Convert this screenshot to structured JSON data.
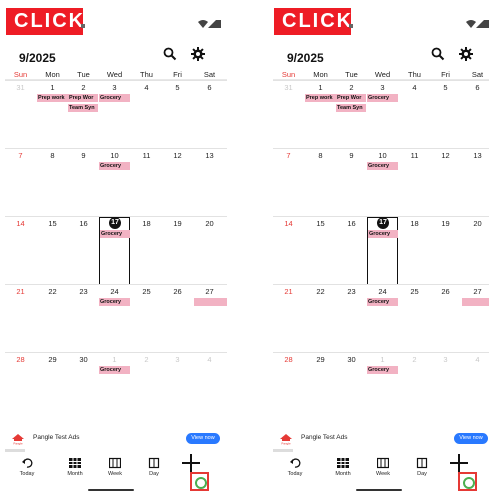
{
  "badge": "CLICK",
  "title": "9/2025",
  "weekdays": [
    "Sun",
    "Mon",
    "Tue",
    "Wed",
    "Thu",
    "Fri",
    "Sat"
  ],
  "weeks": [
    [
      "31",
      "1",
      "2",
      "3",
      "4",
      "5",
      "6"
    ],
    [
      "7",
      "8",
      "9",
      "10",
      "11",
      "12",
      "13"
    ],
    [
      "14",
      "15",
      "16",
      "17",
      "18",
      "19",
      "20"
    ],
    [
      "21",
      "22",
      "23",
      "24",
      "25",
      "26",
      "27"
    ],
    [
      "28",
      "29",
      "30",
      "1",
      "2",
      "3",
      "4"
    ]
  ],
  "events": {
    "prep_work": "Prep work",
    "prep_wor": "Prep Wor",
    "grocery": "Grocery",
    "team_syn": "Team Syn"
  },
  "ad": {
    "text": "Pangle Test Ads",
    "button": "View now",
    "logo_text": "Pangle"
  },
  "nav": {
    "today": "Today",
    "month": "Month",
    "week": "Week",
    "day": "Day"
  },
  "colors": {
    "event": "#f2b2c3",
    "sunday": "#e53935",
    "badge": "#ee1c25",
    "ad_button": "#2979ff",
    "fab_ring": "#4caf50",
    "fab_box": "#e53935"
  },
  "icons": [
    "search-icon",
    "gear-icon",
    "undo-icon",
    "month-grid-icon",
    "week-icon",
    "day-icon",
    "plus-icon",
    "wifi-icon",
    "signal-icon",
    "battery-icon"
  ]
}
